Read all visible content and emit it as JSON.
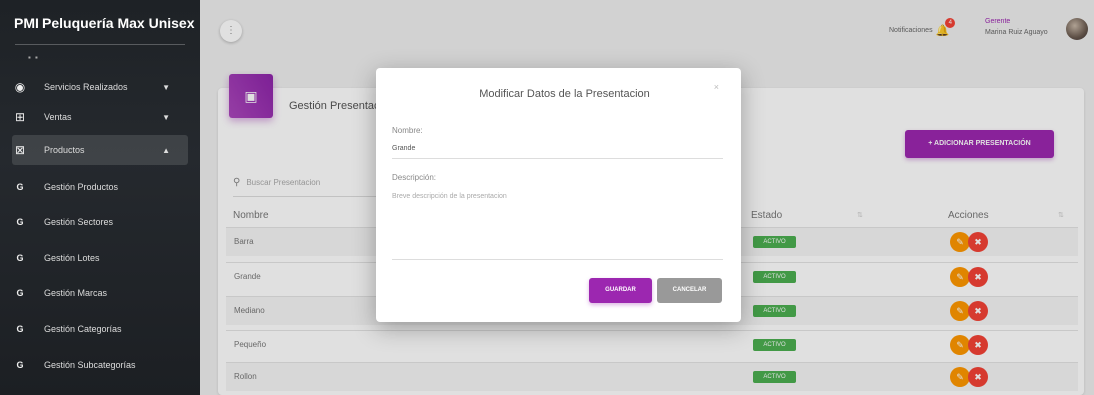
{
  "sidebar": {
    "logo_mini": "PMI",
    "brand": "Peluquería Max Unisex",
    "items": [
      {
        "icon": "eye-icon",
        "glyph": "◉",
        "label": "Servicios Realizados"
      },
      {
        "icon": "cart-icon",
        "glyph": "🛒",
        "label": "Ventas"
      },
      {
        "icon": "basket-icon",
        "glyph": "⛽",
        "label": "Productos"
      }
    ],
    "sub_items": [
      {
        "mini": "G",
        "label": "Gestión Productos"
      },
      {
        "mini": "G",
        "label": "Gestión Sectores"
      },
      {
        "mini": "G",
        "label": "Gestión Lotes"
      },
      {
        "mini": "G",
        "label": "Gestión Marcas"
      },
      {
        "mini": "G",
        "label": "Gestión Categorías"
      },
      {
        "mini": "G",
        "label": "Gestión Subcategorías"
      }
    ]
  },
  "header": {
    "menu_glyph": "⋮",
    "notifications_label": "Notificaciones",
    "notifications_count": "4",
    "user_role": "Gerente",
    "user_name": "Marina Ruiz Aguayo"
  },
  "card": {
    "title": "Gestión Presentaciones",
    "add_button": "+ ADICIONAR PRESENTACIÓN",
    "search_placeholder": "Buscar Presentacion",
    "columns": {
      "name": "Nombre",
      "state": "Estado",
      "actions": "Acciones"
    },
    "rows": [
      {
        "name": "Barra",
        "state": "ACTIVO"
      },
      {
        "name": "Grande",
        "state": "ACTIVO"
      },
      {
        "name": "Mediano",
        "state": "ACTIVO"
      },
      {
        "name": "Pequeño",
        "state": "ACTIVO"
      },
      {
        "name": "Rollon",
        "state": "ACTIVO"
      }
    ]
  },
  "modal": {
    "title": "Modificar Datos de la Presentacion",
    "close": "×",
    "name_label": "Nombre:",
    "name_value": "Grande",
    "desc_label": "Descripción:",
    "desc_placeholder": "Breve descripción de la presentacion",
    "save": "GUARDAR",
    "cancel": "CANCELAR"
  },
  "colors": {
    "accent": "#9c27b0",
    "active": "#4caf50",
    "edit": "#ff9800",
    "delete": "#f44336"
  }
}
